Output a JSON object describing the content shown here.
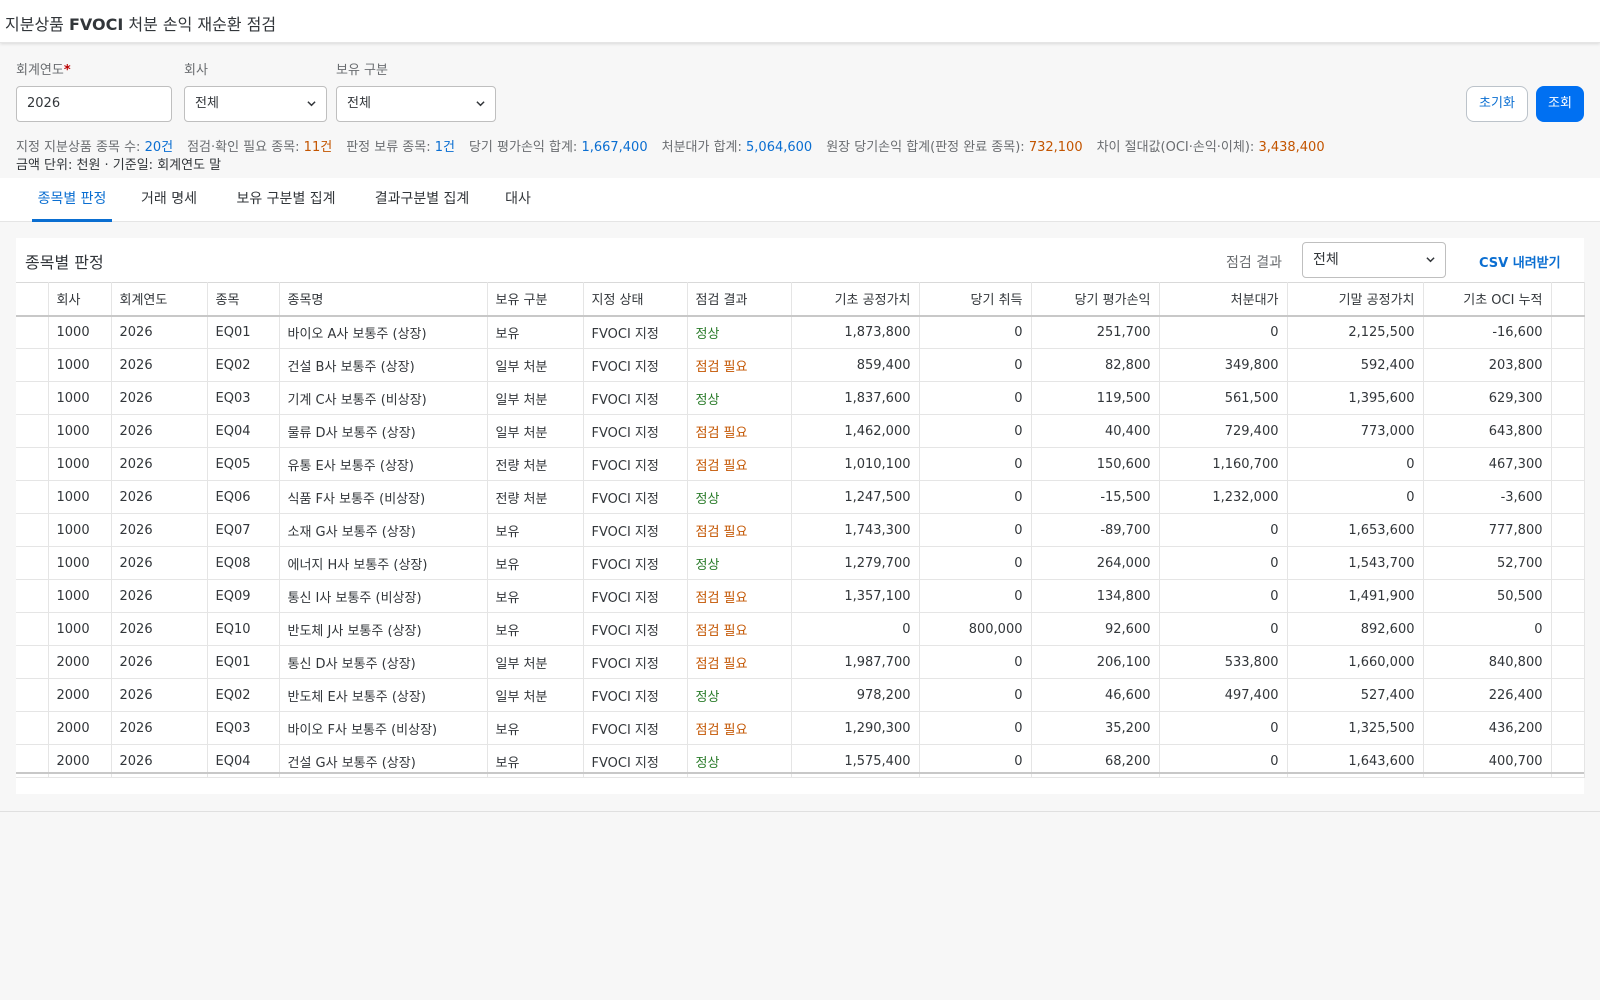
{
  "app": {
    "title_prefix": "지분상품 ",
    "title_bold": "FVOCI",
    "title_suffix": " 처분 손익 재순환 점검"
  },
  "filters": {
    "year_label": "회계연도",
    "year_required": "*",
    "year_value": "2026",
    "company_label": "회사",
    "company_value": "전체",
    "holding_label": "보유 구분",
    "holding_value": "전체",
    "reset_label": "초기화",
    "search_label": "조회"
  },
  "summary": {
    "items": [
      {
        "label": "지정 지분상품 종목 수: ",
        "value": "20건",
        "tone": "blue"
      },
      {
        "label": "점검·확인 필요 종목: ",
        "value": "11건",
        "tone": "orange"
      },
      {
        "label": "판정 보류 종목: ",
        "value": "1건",
        "tone": "blue"
      },
      {
        "label": "당기 평가손익 합계: ",
        "value": "1,667,400",
        "tone": "blue"
      },
      {
        "label": "처분대가 합계: ",
        "value": "5,064,600",
        "tone": "blue"
      },
      {
        "label": "원장 당기손익 합계(판정 완료 종목): ",
        "value": "732,100",
        "tone": "orange"
      },
      {
        "label": "차이 절대값(OCI·손익·이체): ",
        "value": "3,438,400",
        "tone": "orange"
      }
    ],
    "unit_note": "금액 단위: 천원 · 기준일: 회계연도 말"
  },
  "tabs": [
    {
      "label": "종목별 판정",
      "active": true
    },
    {
      "label": "거래 명세",
      "active": false
    },
    {
      "label": "보유 구분별 집계",
      "active": false
    },
    {
      "label": "결과구분별 집계",
      "active": false
    },
    {
      "label": "대사",
      "active": false
    }
  ],
  "panel": {
    "title": "종목별 판정",
    "filter_label": "점검 결과",
    "filter_value": "전체",
    "csv_label": "CSV 내려받기"
  },
  "table": {
    "columns": [
      "회사",
      "회계연도",
      "종목",
      "종목명",
      "보유 구분",
      "지정 상태",
      "점검 결과",
      "기초 공정가치",
      "당기 취득",
      "당기 평가손익",
      "처분대가",
      "기말 공정가치",
      "기초 OCI 누적"
    ],
    "rows": [
      [
        "1000",
        "2026",
        "EQ01",
        "바이오 A사 보통주 (상장)",
        "보유",
        "FVOCI 지정",
        "정상",
        "1,873,800",
        "0",
        "251,700",
        "0",
        "2,125,500",
        "-16,600"
      ],
      [
        "1000",
        "2026",
        "EQ02",
        "건설 B사 보통주 (상장)",
        "일부 처분",
        "FVOCI 지정",
        "점검 필요",
        "859,400",
        "0",
        "82,800",
        "349,800",
        "592,400",
        "203,800"
      ],
      [
        "1000",
        "2026",
        "EQ03",
        "기계 C사 보통주 (비상장)",
        "일부 처분",
        "FVOCI 지정",
        "정상",
        "1,837,600",
        "0",
        "119,500",
        "561,500",
        "1,395,600",
        "629,300"
      ],
      [
        "1000",
        "2026",
        "EQ04",
        "물류 D사 보통주 (상장)",
        "일부 처분",
        "FVOCI 지정",
        "점검 필요",
        "1,462,000",
        "0",
        "40,400",
        "729,400",
        "773,000",
        "643,800"
      ],
      [
        "1000",
        "2026",
        "EQ05",
        "유통 E사 보통주 (상장)",
        "전량 처분",
        "FVOCI 지정",
        "점검 필요",
        "1,010,100",
        "0",
        "150,600",
        "1,160,700",
        "0",
        "467,300"
      ],
      [
        "1000",
        "2026",
        "EQ06",
        "식품 F사 보통주 (비상장)",
        "전량 처분",
        "FVOCI 지정",
        "정상",
        "1,247,500",
        "0",
        "-15,500",
        "1,232,000",
        "0",
        "-3,600"
      ],
      [
        "1000",
        "2026",
        "EQ07",
        "소재 G사 보통주 (상장)",
        "보유",
        "FVOCI 지정",
        "점검 필요",
        "1,743,300",
        "0",
        "-89,700",
        "0",
        "1,653,600",
        "777,800"
      ],
      [
        "1000",
        "2026",
        "EQ08",
        "에너지 H사 보통주 (상장)",
        "보유",
        "FVOCI 지정",
        "정상",
        "1,279,700",
        "0",
        "264,000",
        "0",
        "1,543,700",
        "52,700"
      ],
      [
        "1000",
        "2026",
        "EQ09",
        "통신 I사 보통주 (비상장)",
        "보유",
        "FVOCI 지정",
        "점검 필요",
        "1,357,100",
        "0",
        "134,800",
        "0",
        "1,491,900",
        "50,500"
      ],
      [
        "1000",
        "2026",
        "EQ10",
        "반도체 J사 보통주 (상장)",
        "보유",
        "FVOCI 지정",
        "점검 필요",
        "0",
        "800,000",
        "92,600",
        "0",
        "892,600",
        "0"
      ],
      [
        "2000",
        "2026",
        "EQ01",
        "통신 D사 보통주 (상장)",
        "일부 처분",
        "FVOCI 지정",
        "점검 필요",
        "1,987,700",
        "0",
        "206,100",
        "533,800",
        "1,660,000",
        "840,800"
      ],
      [
        "2000",
        "2026",
        "EQ02",
        "반도체 E사 보통주 (상장)",
        "일부 처분",
        "FVOCI 지정",
        "정상",
        "978,200",
        "0",
        "46,600",
        "497,400",
        "527,400",
        "226,400"
      ],
      [
        "2000",
        "2026",
        "EQ03",
        "바이오 F사 보통주 (비상장)",
        "보유",
        "FVOCI 지정",
        "점검 필요",
        "1,290,300",
        "0",
        "35,200",
        "0",
        "1,325,500",
        "436,200"
      ],
      [
        "2000",
        "2026",
        "EQ04",
        "건설 G사 보통주 (상장)",
        "보유",
        "FVOCI 지정",
        "정상",
        "1,575,400",
        "0",
        "68,200",
        "0",
        "1,643,600",
        "400,700"
      ]
    ]
  },
  "colors": {
    "accent": "#0a6ed1",
    "primary_button": "#0070f2",
    "ok": "#2b7c2b",
    "warn": "#c35500"
  }
}
